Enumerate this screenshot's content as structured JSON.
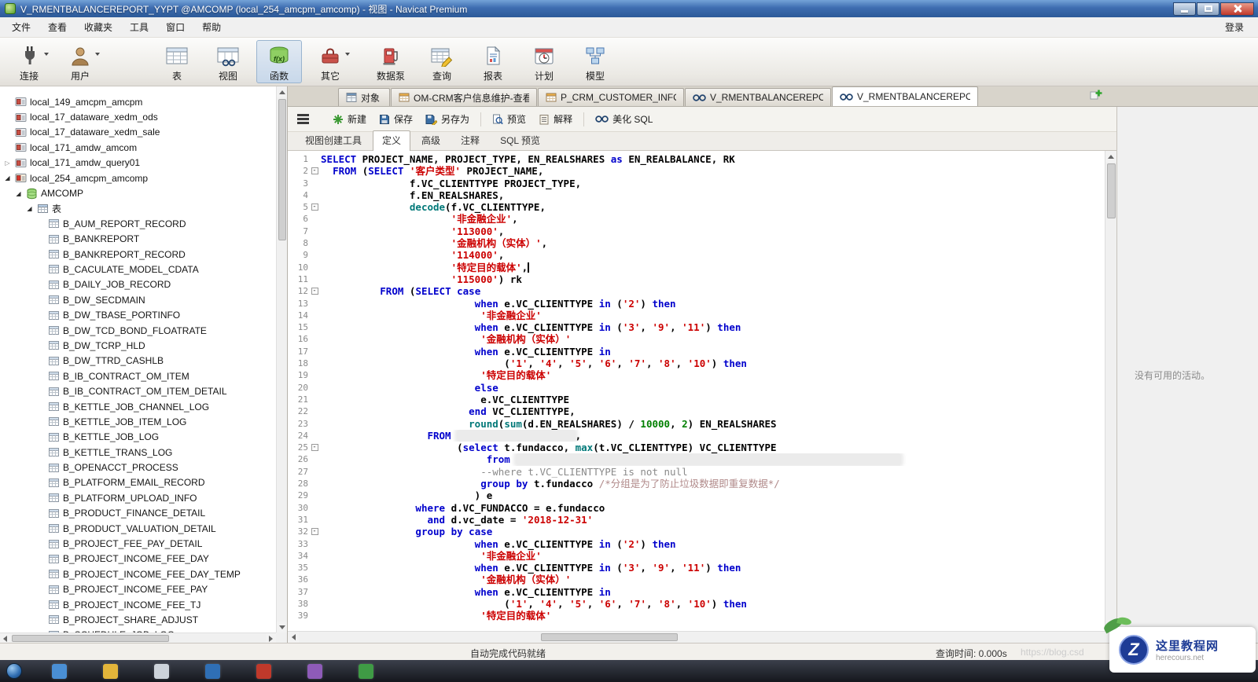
{
  "titlebar": {
    "title": "V_RMENTBALANCEREPORT_YYPT @AMCOMP (local_254_amcpm_amcomp) - 视图 - Navicat Premium"
  },
  "menu": {
    "items": [
      "文件",
      "查看",
      "收藏夹",
      "工具",
      "窗口",
      "帮助"
    ],
    "login": "登录"
  },
  "toolbar": {
    "fx_icon_label": "f(x)",
    "items": [
      {
        "label": "连接",
        "dropdown": true,
        "active": false
      },
      {
        "label": "用户",
        "dropdown": true,
        "active": false
      },
      {
        "label": "表",
        "dropdown": false,
        "active": false
      },
      {
        "label": "视图",
        "dropdown": false,
        "active": false
      },
      {
        "label": "函数",
        "dropdown": false,
        "active": true
      },
      {
        "label": "其它",
        "dropdown": true,
        "active": false
      },
      {
        "label": "数据泵",
        "dropdown": false,
        "active": false
      },
      {
        "label": "查询",
        "dropdown": false,
        "active": false
      },
      {
        "label": "报表",
        "dropdown": false,
        "active": false
      },
      {
        "label": "计划",
        "dropdown": false,
        "active": false
      },
      {
        "label": "模型",
        "dropdown": false,
        "active": false
      }
    ]
  },
  "doc_tabs": [
    {
      "label": "对象",
      "icon": "objects",
      "active": false
    },
    {
      "label": "OM-CRM客户信息维护-查看...",
      "icon": "table",
      "active": false
    },
    {
      "label": "P_CRM_CUSTOMER_INFO ...",
      "icon": "table",
      "active": false
    },
    {
      "label": "V_RMENTBALANCEREPORT...",
      "icon": "view",
      "active": false
    },
    {
      "label": "V_RMENTBALANCEREPORT...",
      "icon": "view",
      "active": true
    }
  ],
  "edit_toolbar": {
    "new": "新建",
    "save": "保存",
    "save_as": "另存为",
    "preview": "预览",
    "explain": "解释",
    "beautify": "美化 SQL"
  },
  "view_tabs": [
    {
      "label": "视图创建工具",
      "active": false
    },
    {
      "label": "定义",
      "active": true
    },
    {
      "label": "高级",
      "active": false
    },
    {
      "label": "注释",
      "active": false
    },
    {
      "label": "SQL 预览",
      "active": false
    }
  ],
  "sidebar": {
    "connections": [
      {
        "label": "local_149_amcpm_amcpm",
        "state": "closed",
        "arrow": ""
      },
      {
        "label": "local_17_dataware_xedm_ods",
        "state": "closed",
        "arrow": ""
      },
      {
        "label": "local_17_dataware_xedm_sale",
        "state": "closed",
        "arrow": ""
      },
      {
        "label": "local_171_amdw_amcom",
        "state": "closed",
        "arrow": ""
      },
      {
        "label": "local_171_amdw_query01",
        "state": "closed",
        "arrow": "collapsed"
      },
      {
        "label": "local_254_amcpm_amcomp",
        "state": "open",
        "arrow": "expanded"
      }
    ],
    "database": {
      "label": "AMCOMP",
      "arrow": "expanded"
    },
    "tables_folder": {
      "label": "表",
      "arrow": "expanded"
    },
    "tables": [
      "B_AUM_REPORT_RECORD",
      "B_BANKREPORT",
      "B_BANKREPORT_RECORD",
      "B_CACULATE_MODEL_CDATA",
      "B_DAILY_JOB_RECORD",
      "B_DW_SECDMAIN",
      "B_DW_TBASE_PORTINFO",
      "B_DW_TCD_BOND_FLOATRATE",
      "B_DW_TCRP_HLD",
      "B_DW_TTRD_CASHLB",
      "B_IB_CONTRACT_OM_ITEM",
      "B_IB_CONTRACT_OM_ITEM_DETAIL",
      "B_KETTLE_JOB_CHANNEL_LOG",
      "B_KETTLE_JOB_ITEM_LOG",
      "B_KETTLE_JOB_LOG",
      "B_KETTLE_TRANS_LOG",
      "B_OPENACCT_PROCESS",
      "B_PLATFORM_EMAIL_RECORD",
      "B_PLATFORM_UPLOAD_INFO",
      "B_PRODUCT_FINANCE_DETAIL",
      "B_PRODUCT_VALUATION_DETAIL",
      "B_PROJECT_FEE_PAY_DETAIL",
      "B_PROJECT_INCOME_FEE_DAY",
      "B_PROJECT_INCOME_FEE_DAY_TEMP",
      "B_PROJECT_INCOME_FEE_PAY",
      "B_PROJECT_INCOME_FEE_TJ",
      "B_PROJECT_SHARE_ADJUST",
      "B_SCHEDULE_JOB_LOG"
    ]
  },
  "code": {
    "caret_line": 10,
    "lines": [
      {
        "n": 1,
        "seg": [
          [
            "kw",
            "SELECT"
          ],
          [
            "pl",
            " PROJECT_NAME, PROJECT_TYPE, EN_REALSHARES "
          ],
          [
            "kw",
            "as"
          ],
          [
            "pl",
            " EN_REALBALANCE, RK"
          ]
        ]
      },
      {
        "n": 2,
        "fold": true,
        "seg": [
          [
            "pl",
            "  "
          ],
          [
            "kw",
            "FROM"
          ],
          [
            "pl",
            " ("
          ],
          [
            "kw",
            "SELECT"
          ],
          [
            "pl",
            " "
          ],
          [
            "str",
            "'客户类型'"
          ],
          [
            "pl",
            " PROJECT_NAME,"
          ]
        ]
      },
      {
        "n": 3,
        "seg": [
          [
            "pl",
            "               f.VC_CLIENTTYPE PROJECT_TYPE,"
          ]
        ]
      },
      {
        "n": 4,
        "seg": [
          [
            "pl",
            "               f.EN_REALSHARES,"
          ]
        ]
      },
      {
        "n": 5,
        "fold": true,
        "seg": [
          [
            "pl",
            "               "
          ],
          [
            "fn",
            "decode"
          ],
          [
            "pl",
            "(f.VC_CLIENTTYPE,"
          ]
        ]
      },
      {
        "n": 6,
        "seg": [
          [
            "pl",
            "                      "
          ],
          [
            "str",
            "'非金融企业'"
          ],
          [
            "pl",
            ","
          ]
        ]
      },
      {
        "n": 7,
        "seg": [
          [
            "pl",
            "                      "
          ],
          [
            "str",
            "'113000'"
          ],
          [
            "pl",
            ","
          ]
        ]
      },
      {
        "n": 8,
        "seg": [
          [
            "pl",
            "                      "
          ],
          [
            "str",
            "'金融机构（实体）'"
          ],
          [
            "pl",
            ","
          ]
        ]
      },
      {
        "n": 9,
        "seg": [
          [
            "pl",
            "                      "
          ],
          [
            "str",
            "'114000'"
          ],
          [
            "pl",
            ","
          ]
        ]
      },
      {
        "n": 10,
        "seg": [
          [
            "pl",
            "                      "
          ],
          [
            "str",
            "'特定目的载体'"
          ],
          [
            "pl",
            ","
          ]
        ]
      },
      {
        "n": 11,
        "seg": [
          [
            "pl",
            "                      "
          ],
          [
            "str",
            "'115000'"
          ],
          [
            "pl",
            ") rk"
          ]
        ]
      },
      {
        "n": 12,
        "fold": true,
        "seg": [
          [
            "pl",
            "          "
          ],
          [
            "kw",
            "FROM"
          ],
          [
            "pl",
            " ("
          ],
          [
            "kw",
            "SELECT"
          ],
          [
            "pl",
            " "
          ],
          [
            "kw",
            "case"
          ]
        ]
      },
      {
        "n": 13,
        "seg": [
          [
            "pl",
            "                          "
          ],
          [
            "kw",
            "when"
          ],
          [
            "pl",
            " e.VC_CLIENTTYPE "
          ],
          [
            "kw",
            "in"
          ],
          [
            "pl",
            " ("
          ],
          [
            "str",
            "'2'"
          ],
          [
            "pl",
            ") "
          ],
          [
            "kw",
            "then"
          ]
        ]
      },
      {
        "n": 14,
        "seg": [
          [
            "pl",
            "                           "
          ],
          [
            "str",
            "'非金融企业'"
          ]
        ]
      },
      {
        "n": 15,
        "seg": [
          [
            "pl",
            "                          "
          ],
          [
            "kw",
            "when"
          ],
          [
            "pl",
            " e.VC_CLIENTTYPE "
          ],
          [
            "kw",
            "in"
          ],
          [
            "pl",
            " ("
          ],
          [
            "str",
            "'3'"
          ],
          [
            "pl",
            ", "
          ],
          [
            "str",
            "'9'"
          ],
          [
            "pl",
            ", "
          ],
          [
            "str",
            "'11'"
          ],
          [
            "pl",
            ") "
          ],
          [
            "kw",
            "then"
          ]
        ]
      },
      {
        "n": 16,
        "seg": [
          [
            "pl",
            "                           "
          ],
          [
            "str",
            "'金融机构（实体）'"
          ]
        ]
      },
      {
        "n": 17,
        "seg": [
          [
            "pl",
            "                          "
          ],
          [
            "kw",
            "when"
          ],
          [
            "pl",
            " e.VC_CLIENTTYPE "
          ],
          [
            "kw",
            "in"
          ]
        ]
      },
      {
        "n": 18,
        "seg": [
          [
            "pl",
            "                               ("
          ],
          [
            "str",
            "'1'"
          ],
          [
            "pl",
            ", "
          ],
          [
            "str",
            "'4'"
          ],
          [
            "pl",
            ", "
          ],
          [
            "str",
            "'5'"
          ],
          [
            "pl",
            ", "
          ],
          [
            "str",
            "'6'"
          ],
          [
            "pl",
            ", "
          ],
          [
            "str",
            "'7'"
          ],
          [
            "pl",
            ", "
          ],
          [
            "str",
            "'8'"
          ],
          [
            "pl",
            ", "
          ],
          [
            "str",
            "'10'"
          ],
          [
            "pl",
            ") "
          ],
          [
            "kw",
            "then"
          ]
        ]
      },
      {
        "n": 19,
        "seg": [
          [
            "pl",
            "                           "
          ],
          [
            "str",
            "'特定目的载体'"
          ]
        ]
      },
      {
        "n": 20,
        "seg": [
          [
            "pl",
            "                          "
          ],
          [
            "kw",
            "else"
          ]
        ]
      },
      {
        "n": 21,
        "seg": [
          [
            "pl",
            "                           e.VC_CLIENTTYPE"
          ]
        ]
      },
      {
        "n": 22,
        "seg": [
          [
            "pl",
            "                         "
          ],
          [
            "kw",
            "end"
          ],
          [
            "pl",
            " VC_CLIENTTYPE,"
          ]
        ]
      },
      {
        "n": 23,
        "seg": [
          [
            "pl",
            "                         "
          ],
          [
            "fn",
            "round"
          ],
          [
            "pl",
            "("
          ],
          [
            "fn",
            "sum"
          ],
          [
            "pl",
            "(d.EN_REALSHARES) / "
          ],
          [
            "num",
            "10000"
          ],
          [
            "pl",
            ", "
          ],
          [
            "num",
            "2"
          ],
          [
            "pl",
            ") EN_REALSHARES"
          ]
        ]
      },
      {
        "n": 24,
        "seg": [
          [
            "pl",
            "                  "
          ],
          [
            "kw",
            "FROM"
          ],
          [
            "pl",
            " "
          ],
          [
            "red",
            "                    "
          ],
          [
            "pl",
            ","
          ]
        ]
      },
      {
        "n": 25,
        "fold": true,
        "seg": [
          [
            "pl",
            "                       ("
          ],
          [
            "kw",
            "select"
          ],
          [
            "pl",
            " t.fundacco, "
          ],
          [
            "fn",
            "max"
          ],
          [
            "pl",
            "(t.VC_CLIENTTYPE) VC_CLIENTTYPE"
          ]
        ]
      },
      {
        "n": 26,
        "seg": [
          [
            "pl",
            "                            "
          ],
          [
            "kw",
            "from"
          ],
          [
            "pl",
            " "
          ],
          [
            "red",
            "                                                                 "
          ]
        ]
      },
      {
        "n": 27,
        "seg": [
          [
            "pl",
            "                           "
          ],
          [
            "cm",
            "--where t.VC_CLIENTTYPE is not null"
          ]
        ]
      },
      {
        "n": 28,
        "seg": [
          [
            "pl",
            "                           "
          ],
          [
            "kw",
            "group by"
          ],
          [
            "pl",
            " t.fundacco "
          ],
          [
            "cmb",
            "/*分组是为了防止垃圾数据即重复数据*/"
          ]
        ]
      },
      {
        "n": 29,
        "seg": [
          [
            "pl",
            "                          ) e"
          ]
        ]
      },
      {
        "n": 30,
        "seg": [
          [
            "pl",
            "                "
          ],
          [
            "kw",
            "where"
          ],
          [
            "pl",
            " d.VC_FUNDACCO = e.fundacco"
          ]
        ]
      },
      {
        "n": 31,
        "seg": [
          [
            "pl",
            "                  "
          ],
          [
            "kw",
            "and"
          ],
          [
            "pl",
            " d.vc_date = "
          ],
          [
            "str",
            "'2018-12-31'"
          ]
        ]
      },
      {
        "n": 32,
        "fold": true,
        "seg": [
          [
            "pl",
            "                "
          ],
          [
            "kw",
            "group by"
          ],
          [
            "pl",
            " "
          ],
          [
            "kw",
            "case"
          ]
        ]
      },
      {
        "n": 33,
        "seg": [
          [
            "pl",
            "                          "
          ],
          [
            "kw",
            "when"
          ],
          [
            "pl",
            " e.VC_CLIENTTYPE "
          ],
          [
            "kw",
            "in"
          ],
          [
            "pl",
            " ("
          ],
          [
            "str",
            "'2'"
          ],
          [
            "pl",
            ") "
          ],
          [
            "kw",
            "then"
          ]
        ]
      },
      {
        "n": 34,
        "seg": [
          [
            "pl",
            "                           "
          ],
          [
            "str",
            "'非金融企业'"
          ]
        ]
      },
      {
        "n": 35,
        "seg": [
          [
            "pl",
            "                          "
          ],
          [
            "kw",
            "when"
          ],
          [
            "pl",
            " e.VC_CLIENTTYPE "
          ],
          [
            "kw",
            "in"
          ],
          [
            "pl",
            " ("
          ],
          [
            "str",
            "'3'"
          ],
          [
            "pl",
            ", "
          ],
          [
            "str",
            "'9'"
          ],
          [
            "pl",
            ", "
          ],
          [
            "str",
            "'11'"
          ],
          [
            "pl",
            ") "
          ],
          [
            "kw",
            "then"
          ]
        ]
      },
      {
        "n": 36,
        "seg": [
          [
            "pl",
            "                           "
          ],
          [
            "str",
            "'金融机构（实体）'"
          ]
        ]
      },
      {
        "n": 37,
        "seg": [
          [
            "pl",
            "                          "
          ],
          [
            "kw",
            "when"
          ],
          [
            "pl",
            " e.VC_CLIENTTYPE "
          ],
          [
            "kw",
            "in"
          ]
        ]
      },
      {
        "n": 38,
        "seg": [
          [
            "pl",
            "                               ("
          ],
          [
            "str",
            "'1'"
          ],
          [
            "pl",
            ", "
          ],
          [
            "str",
            "'4'"
          ],
          [
            "pl",
            ", "
          ],
          [
            "str",
            "'5'"
          ],
          [
            "pl",
            ", "
          ],
          [
            "str",
            "'6'"
          ],
          [
            "pl",
            ", "
          ],
          [
            "str",
            "'7'"
          ],
          [
            "pl",
            ", "
          ],
          [
            "str",
            "'8'"
          ],
          [
            "pl",
            ", "
          ],
          [
            "str",
            "'10'"
          ],
          [
            "pl",
            ") "
          ],
          [
            "kw",
            "then"
          ]
        ]
      },
      {
        "n": 39,
        "seg": [
          [
            "pl",
            "                           "
          ],
          [
            "str",
            "'特定目的载体'"
          ]
        ]
      }
    ]
  },
  "right_panel": {
    "empty_text": "没有可用的活动。"
  },
  "status": {
    "left": "自动完成代码就绪",
    "right": "查询时间: 0.000s",
    "url": "https://blog.csd"
  },
  "watermark": {
    "logo": "Z",
    "line1": "这里教程网",
    "line2": "herecours.net"
  }
}
